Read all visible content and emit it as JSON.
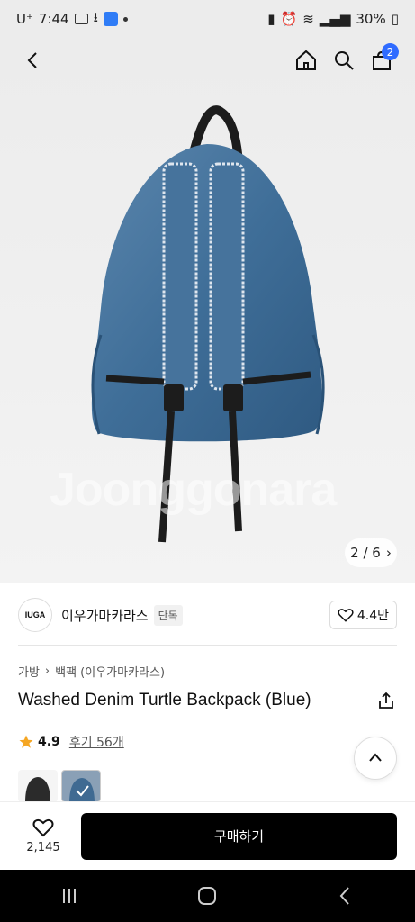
{
  "status_bar": {
    "carrier": "U⁺",
    "time": "7:44",
    "battery": "30%"
  },
  "header": {
    "cart_count": "2"
  },
  "hero": {
    "watermark": "Joonggonara",
    "pager": "2 / 6"
  },
  "brand": {
    "logo_text": "IUGA",
    "name": "이우가마카라스",
    "tag": "단독",
    "likes": "4.4만"
  },
  "product": {
    "breadcrumb": [
      "가방",
      "백팩 (이우가마카라스)"
    ],
    "title": "Washed Denim Turtle Backpack (Blue)",
    "rating": "4.9",
    "reviews": "후기 56개"
  },
  "bottom": {
    "wish_count": "2,145",
    "buy_label": "구매하기"
  },
  "colors": {
    "accent": "#2f6bff",
    "buy_button": "#000000",
    "star": "#f5a623"
  }
}
